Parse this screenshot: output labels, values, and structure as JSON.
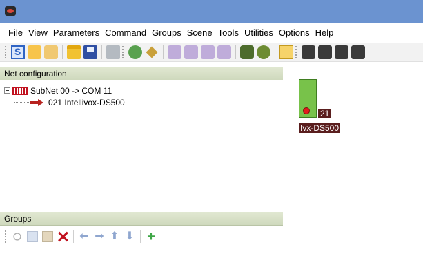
{
  "menu": [
    "File",
    "View",
    "Parameters",
    "Command",
    "Groups",
    "Scene",
    "Tools",
    "Utilities",
    "Options",
    "Help"
  ],
  "net_panel": {
    "title": "Net configuration",
    "subnet_label": "SubNet 00 -> COM  11",
    "device_label": "021 Intellivox-DS500"
  },
  "groups_panel": {
    "title": "Groups"
  },
  "canvas": {
    "node_address": "21",
    "node_name": "Ivx-DS500"
  },
  "colors": {
    "title_bar": "#6b93d0",
    "panel_header": "#d7e0c8",
    "node_fill": "#78c24a",
    "node_led": "#e31b1b",
    "label_bg": "#5a1e1e"
  }
}
